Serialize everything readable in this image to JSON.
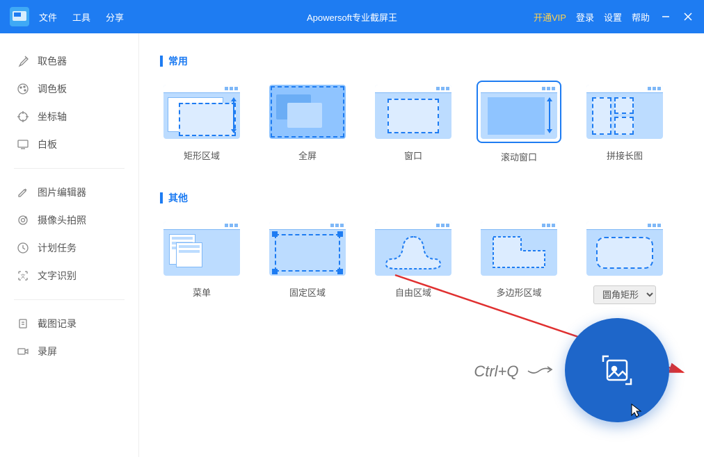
{
  "app": {
    "title": "Apowersoft专业截屏王",
    "menu": {
      "file": "文件",
      "tools": "工具",
      "share": "分享"
    },
    "controls": {
      "vip": "开通VIP",
      "login": "登录",
      "settings": "设置",
      "help": "帮助"
    }
  },
  "sidebar": {
    "group1": [
      {
        "label": "取色器",
        "icon": "eyedropper-icon"
      },
      {
        "label": "调色板",
        "icon": "palette-icon"
      },
      {
        "label": "坐标轴",
        "icon": "crosshair-icon"
      },
      {
        "label": "白板",
        "icon": "whiteboard-icon"
      }
    ],
    "group2": [
      {
        "label": "图片编辑器",
        "icon": "edit-icon"
      },
      {
        "label": "摄像头拍照",
        "icon": "camera-icon"
      },
      {
        "label": "计划任务",
        "icon": "clock-icon"
      },
      {
        "label": "文字识别",
        "icon": "ocr-icon"
      }
    ],
    "group3": [
      {
        "label": "截图记录",
        "icon": "history-icon"
      },
      {
        "label": "录屏",
        "icon": "record-icon"
      }
    ]
  },
  "main": {
    "sections": {
      "common": {
        "title": "常用"
      },
      "other": {
        "title": "其他"
      }
    },
    "modes_common": [
      {
        "label": "矩形区域"
      },
      {
        "label": "全屏"
      },
      {
        "label": "窗口"
      },
      {
        "label": "滚动窗口",
        "selected": true
      },
      {
        "label": "拼接长图"
      }
    ],
    "modes_other": [
      {
        "label": "菜单"
      },
      {
        "label": "固定区域"
      },
      {
        "label": "自由区域"
      },
      {
        "label": "多边形区域"
      }
    ],
    "shape_select": {
      "value": "圆角矩形"
    },
    "hint": "Ctrl+Q",
    "colors": {
      "primary": "#1e7cf2",
      "fab": "#1e66c9",
      "thumb_bg": "#bcdcff"
    }
  }
}
